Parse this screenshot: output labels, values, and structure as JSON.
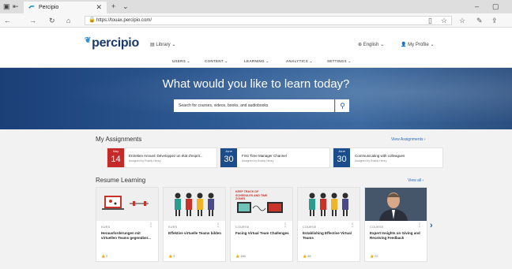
{
  "browser": {
    "tab_title": "Percipio",
    "url": "https://touax.percipio.com/"
  },
  "header": {
    "logo": "percipio",
    "library_label": "Library",
    "language_label": "English",
    "profile_label": "My Profile",
    "menu": [
      "USERS",
      "CONTENT",
      "LEARNING",
      "ANALYTICS",
      "SETTINGS"
    ]
  },
  "hero": {
    "title": "What would you like to learn today?",
    "search_placeholder": "Search for courses, videos, books, and audiobooks"
  },
  "assignments": {
    "heading": "My Assignments",
    "view_link": "View Assignments",
    "items": [
      {
        "month": "May",
        "day": "14",
        "title": "Entretien Annuel: Développez un état d'esprit...",
        "by": "Assigned by Ruddy Henry",
        "color": "#c42a2a"
      },
      {
        "month": "June",
        "day": "30",
        "title": "First Time Manager Channel",
        "by": "Assigned by Ruddy Henry",
        "color": "#1b4c8c"
      },
      {
        "month": "June",
        "day": "30",
        "title": "Communicating with colleagues",
        "by": "Assigned by Ruddy Henry",
        "color": "#1b4c8c"
      }
    ]
  },
  "resume": {
    "heading": "Resume Learning",
    "view_link": "View all",
    "cards": [
      {
        "kind": "KURS",
        "title": "Herausforderungen mit virtuellen Teams gegenüber...",
        "likes": "2"
      },
      {
        "kind": "KURS",
        "title": "Effektive virtuelle Teams bilden",
        "likes": "3"
      },
      {
        "kind": "COURSE",
        "title": "Facing Virtual Team Challenges",
        "likes": "166",
        "img_text": "KEEP TRACK OF SCHEDULES AND TIME ZONES"
      },
      {
        "kind": "COURSE",
        "title": "Establishing Effective Virtual Teams",
        "likes": "38"
      },
      {
        "kind": "COURSE",
        "title": "Expert Insights on Giving and Receiving Feedback",
        "likes": "22"
      }
    ]
  },
  "colors": {
    "brand": "#1a3a6b",
    "accent": "#2a6ebd",
    "may": "#c42a2a",
    "june": "#1b4c8c"
  }
}
